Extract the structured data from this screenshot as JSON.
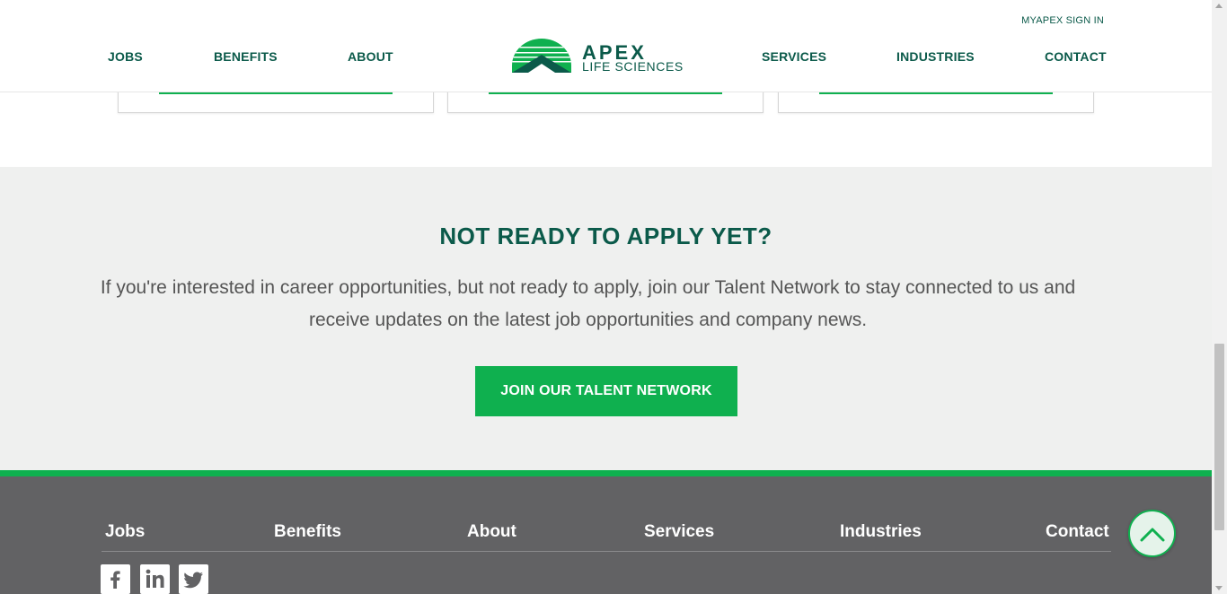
{
  "header": {
    "signin_label": "MYAPEX SIGN IN",
    "nav_left": [
      "JOBS",
      "BENEFITS",
      "ABOUT"
    ],
    "nav_right": [
      "SERVICES",
      "INDUSTRIES",
      "CONTACT"
    ],
    "logo": {
      "name": "APEX",
      "tagline": "LIFE SCIENCES"
    }
  },
  "cta": {
    "title": "NOT READY TO APPLY YET?",
    "text": "If you're interested in career opportunities, but not ready to apply, join our Talent Network to stay connected to us and receive updates on the latest job opportunities and company news.",
    "button_label": "JOIN OUR TALENT NETWORK"
  },
  "footer": {
    "links": [
      "Jobs",
      "Benefits",
      "About",
      "Services",
      "Industries",
      "Contact"
    ],
    "social_icons": [
      "facebook-icon",
      "linkedin-icon",
      "twitter-icon"
    ]
  },
  "colors": {
    "brand_dark": "#0b5a4a",
    "brand_green": "#0fb04f",
    "cta_bg": "#eff0ef",
    "footer_bg": "#626264"
  }
}
